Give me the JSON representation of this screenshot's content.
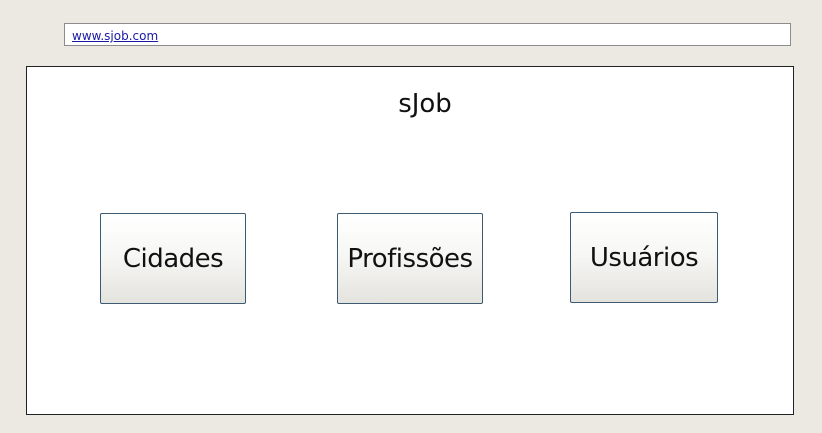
{
  "address": {
    "url": "www.sjob.com"
  },
  "app": {
    "title": "sJob"
  },
  "menu": {
    "buttons": [
      {
        "label": "Cidades"
      },
      {
        "label": "Profissões"
      },
      {
        "label": "Usuários"
      }
    ]
  }
}
